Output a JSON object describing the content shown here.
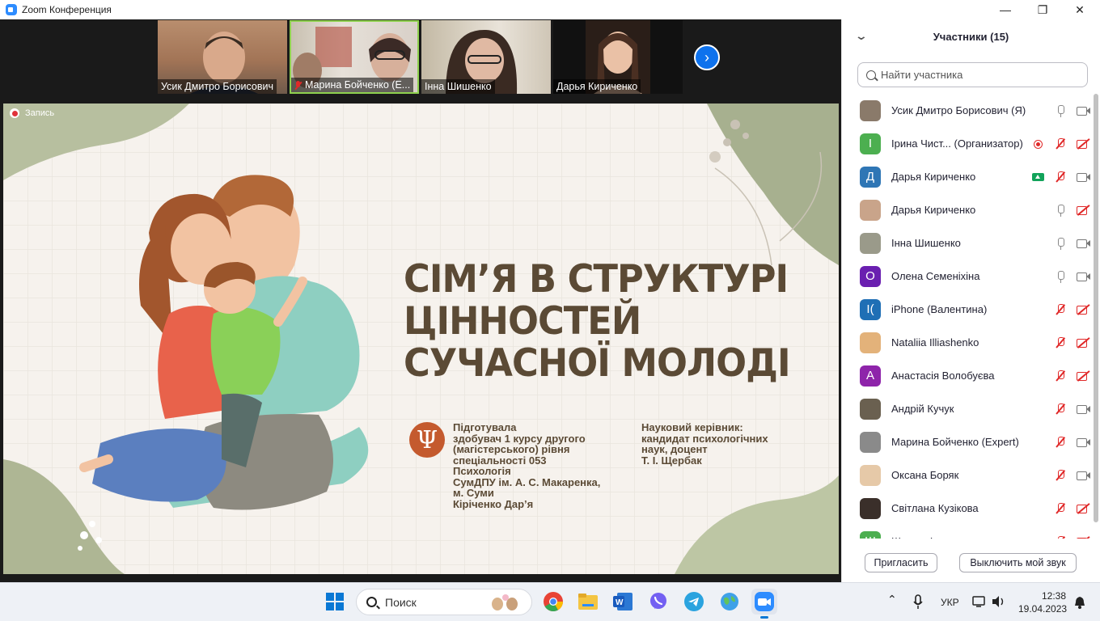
{
  "window": {
    "title": "Zoom Конференция",
    "min": "—",
    "max": "❐",
    "close": "✕"
  },
  "thumbnails": [
    {
      "name": "Усик Дмитро Борисович",
      "muted": false
    },
    {
      "name": "Марина Бойченко (Е...",
      "muted": true
    },
    {
      "name": "Інна Шишенко",
      "muted": false
    },
    {
      "name": "Дарья Кириченко",
      "muted": false
    }
  ],
  "next_arrow": "›",
  "recording": {
    "label": "Запись"
  },
  "slide": {
    "title_lines": [
      "СІМ’Я В СТРУКТУРІ",
      "ЦІННОСТЕЙ",
      "СУЧАСНОЇ МОЛОДІ"
    ],
    "logo_glyph": "Ψ",
    "prepared_lines": [
      "Підготувала",
      "здобувач 1 курсу другого",
      "(магістерського) рівня",
      "спеціальності 053",
      "Психологія",
      "СумДПУ ім. А. С. Макаренка,",
      "м. Суми",
      "Кіріченко Дар’я"
    ],
    "supervisor_lines": [
      "Науковий керівник:",
      "кандидат психологічних",
      "наук, доцент",
      "Т. І. Щербак"
    ]
  },
  "panel": {
    "title": "Участники (15)",
    "collapse_glyph": "⌄",
    "search_placeholder": "Найти участника",
    "participants": [
      {
        "name": "Усик Дмитро Борисович (Я)",
        "avatar": "",
        "avatar_color": "#8a7a6a",
        "mic": "on",
        "cam": "on"
      },
      {
        "name": "Ірина Чист...  (Организатор)",
        "avatar": "І",
        "avatar_color": "#4caf50",
        "mic": "off",
        "cam": "off",
        "recording": true
      },
      {
        "name": "Дарья Кириченко",
        "avatar": "Д",
        "avatar_color": "#2f76b5",
        "mic": "off",
        "cam": "on",
        "sharing": true
      },
      {
        "name": "Дарья Кириченко",
        "avatar": "",
        "avatar_color": "#c9a48a",
        "mic": "on",
        "cam": "off"
      },
      {
        "name": "Інна Шишенко",
        "avatar": "",
        "avatar_color": "#9a9a8a",
        "mic": "on",
        "cam": "on"
      },
      {
        "name": "Олена Семеніхіна",
        "avatar": "О",
        "avatar_color": "#6a1fb0",
        "mic": "on",
        "cam": "on"
      },
      {
        "name": "iPhone (Валентина)",
        "avatar": "I(",
        "avatar_color": "#1f6fb5",
        "mic": "off",
        "cam": "off"
      },
      {
        "name": "Nataliia Illiashenko",
        "avatar": "",
        "avatar_color": "#e3b27a",
        "mic": "off",
        "cam": "off"
      },
      {
        "name": "Анастасія Волобуєва",
        "avatar": "А",
        "avatar_color": "#8e24aa",
        "mic": "off",
        "cam": "off"
      },
      {
        "name": "Андрій Кучук",
        "avatar": "",
        "avatar_color": "#6a6050",
        "mic": "off",
        "cam": "on"
      },
      {
        "name": "Марина Бойченко (Expert)",
        "avatar": "",
        "avatar_color": "#8a8a8a",
        "mic": "off",
        "cam": "on"
      },
      {
        "name": "Оксана Боряк",
        "avatar": "",
        "avatar_color": "#e6c9a8",
        "mic": "off",
        "cam": "on"
      },
      {
        "name": "Світлана Кузікова",
        "avatar": "",
        "avatar_color": "#3a2f2a",
        "mic": "off",
        "cam": "off"
      },
      {
        "name": "Шульга Ілля",
        "avatar": "Ш",
        "avatar_color": "#4caf50",
        "mic": "off",
        "cam": "off"
      }
    ],
    "invite_label": "Пригласить",
    "mute_label": "Выключить мой звук"
  },
  "taskbar": {
    "search_label": "Поиск",
    "lang": "УКР",
    "time": "12:38",
    "date": "19.04.2023",
    "tray_arrow": "⌃"
  }
}
